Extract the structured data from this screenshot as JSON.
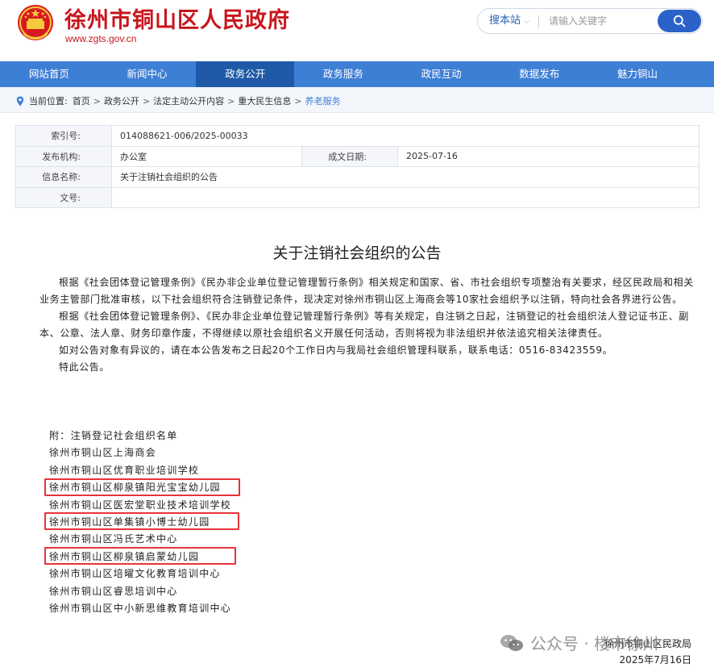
{
  "header": {
    "site_title": "徐州市铜山区人民政府",
    "site_domain": "www.zgts.gov.cn",
    "search": {
      "scope_label": "搜本站",
      "placeholder": "请输入关键字"
    }
  },
  "nav": {
    "items": [
      "网站首页",
      "新闻中心",
      "政务公开",
      "政务服务",
      "政民互动",
      "数据发布",
      "魅力铜山"
    ],
    "active_index": 2
  },
  "breadcrumb": {
    "label": "当前位置:",
    "items": [
      "首页",
      "政务公开",
      "法定主动公开内容",
      "重大民生信息"
    ],
    "current": "养老服务"
  },
  "info": {
    "index_label": "索引号:",
    "index_value": "014088621-006/2025-00033",
    "publisher_label": "发布机构:",
    "publisher_value": "办公室",
    "date_label": "成文日期:",
    "date_value": "2025-07-16",
    "name_label": "信息名称:",
    "name_value": "关于注销社会组织的公告",
    "docno_label": "文号:",
    "docno_value": ""
  },
  "article": {
    "title": "关于注销社会组织的公告",
    "paragraphs": [
      "根据《社会团体登记管理条例》《民办非企业单位登记管理暂行条例》相关规定和国家、省、市社会组织专项整治有关要求，经区民政局和相关业务主管部门批准审核，以下社会组织符合注销登记条件，现决定对徐州市铜山区上海商会等10家社会组织予以注销，特向社会各界进行公告。",
      "根据《社会团体登记管理条例》、《民办非企业单位登记管理暂行条例》等有关规定，自注销之日起，注销登记的社会组织法人登记证书正、副本、公章、法人章、财务印章作废，不得继续以原社会组织名义开展任何活动，否则将视为非法组织并依法追究相关法律责任。",
      "如对公告对象有异议的，请在本公告发布之日起20个工作日内与我局社会组织管理科联系，联系电话：0516-83423559。",
      "特此公告。"
    ],
    "list_heading": "附：注销登记社会组织名单",
    "list": [
      "徐州市铜山区上海商会",
      "徐州市铜山区优育职业培训学校",
      "徐州市铜山区柳泉镇阳光宝宝幼儿园",
      "徐州市铜山区医宏堂职业技术培训学校",
      "徐州市铜山区单集镇小博士幼儿园",
      "徐州市铜山区冯氏艺术中心",
      "徐州市铜山区柳泉镇启蒙幼儿园",
      "徐州市铜山区培曜文化教育培训中心",
      "徐州市铜山区睿思培训中心",
      "徐州市铜山区中小新思维教育培训中心"
    ],
    "highlighted_indices": [
      2,
      4,
      6
    ],
    "signer": "徐州市铜山区民政局",
    "sign_date": "2025年7月16日"
  },
  "watermark": {
    "text": "公众号 · 楼市徐州"
  },
  "colors": {
    "brand_red": "#c8161d",
    "nav_blue": "#3e7fd6",
    "nav_active": "#1f5aa8",
    "highlight_red": "#e5343a"
  }
}
